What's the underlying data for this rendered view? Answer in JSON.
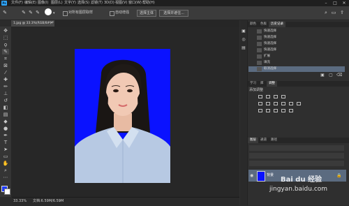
{
  "menubar": {
    "logo": "Ps",
    "items": [
      "文件(F)",
      "编辑(E)",
      "图像(I)",
      "图层(L)",
      "文字(Y)",
      "选择(S)",
      "滤镜(T)",
      "3D(D)",
      "视图(V)",
      "窗口(W)",
      "帮助(H)"
    ],
    "window_controls": {
      "min": "–",
      "max": "□",
      "close": "✕"
    }
  },
  "options": {
    "sample_all_layers": "对所有图层取样",
    "auto_enhance": "自动增强",
    "select_subject": "选择主体",
    "select_and_mask": "选择并遮住..."
  },
  "document": {
    "tab_label": "1.jpg @ 33.3%(RGB/8#) *",
    "zoom": "33.33%",
    "doc_info": "文档:6.59M/6.59M"
  },
  "panels": {
    "top_tabs": [
      "颜色",
      "色板",
      "历史记录"
    ],
    "history": [
      "快速选择",
      "快速选择",
      "快速选择",
      "快速选择",
      "扩展",
      "填充",
      "取消选择"
    ],
    "mid_tabs": [
      "学习",
      "库",
      "调整"
    ],
    "adjust_title": "添加调整",
    "layer_tabs": [
      "图层",
      "通道",
      "路径"
    ],
    "layer_name": "背景"
  },
  "colors": {
    "photo_bg": "#0a12ff",
    "ps_blue": "#31a8ff",
    "selection": "#5b6b80"
  },
  "watermark": {
    "text1": "Bai du 经验",
    "text2": "jingyan.baidu.com"
  }
}
